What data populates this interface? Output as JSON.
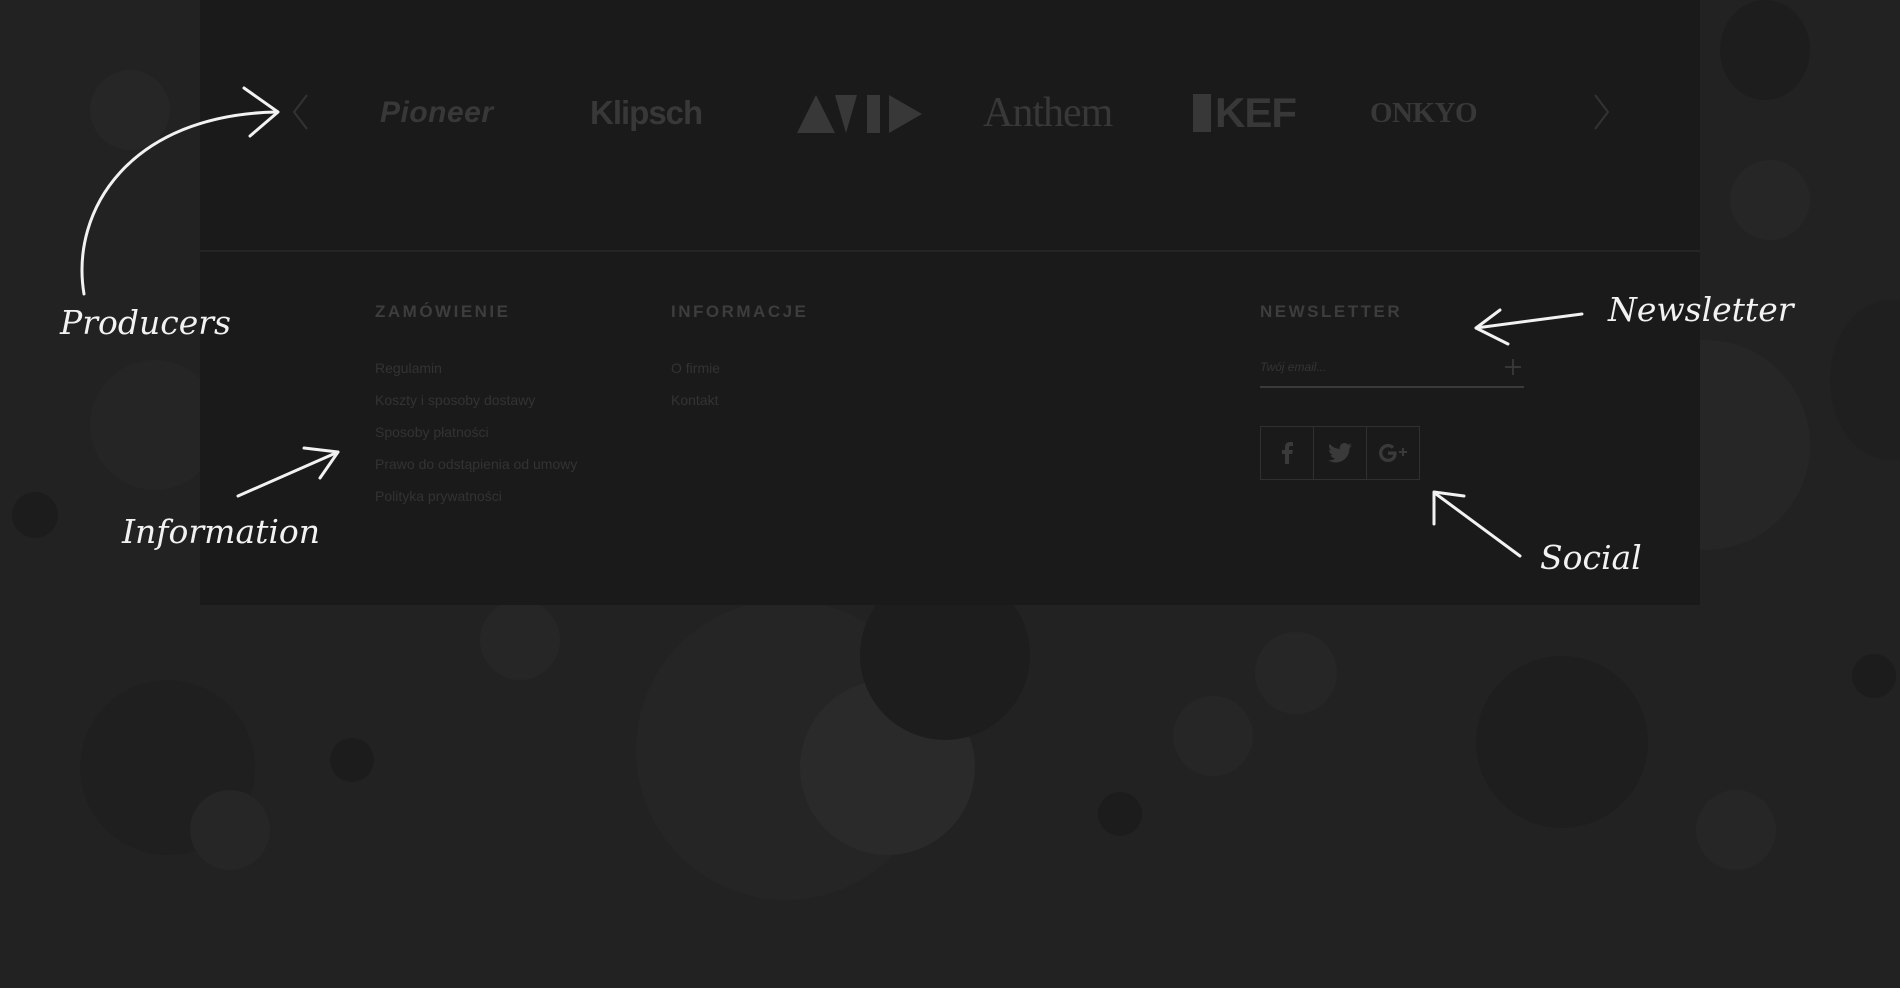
{
  "carousel": {
    "prev_label": "‹",
    "next_label": "›",
    "brands": [
      {
        "name": "Pioneer"
      },
      {
        "name": "Klipsch"
      },
      {
        "name": "AVID"
      },
      {
        "name": "Anthem"
      },
      {
        "name": "KEF"
      },
      {
        "name": "ONKYO"
      }
    ]
  },
  "footer": {
    "order": {
      "title": "ZAMÓWIENIE",
      "links": [
        "Regulamin",
        "Koszty i sposoby dostawy",
        "Sposoby płatności",
        "Prawo do odstąpienia od umowy",
        "Polityka prywatności"
      ]
    },
    "info": {
      "title": "INFORMACJE",
      "links": [
        "O firmie",
        "Kontakt"
      ]
    },
    "newsletter": {
      "title": "NEWSLETTER",
      "placeholder": "Twój email...",
      "submit_icon": "plus-icon"
    },
    "social": [
      "facebook-icon",
      "twitter-icon",
      "google-plus-icon"
    ]
  },
  "annotations": {
    "producers": "Producers",
    "information": "Information",
    "newsletter": "Newsletter",
    "social": "Social",
    "color": "#f2f2f2"
  },
  "colors": {
    "page_bg": "#222222",
    "panel_bg": "#1a1a1a",
    "muted_text": "#3d3d3d"
  }
}
